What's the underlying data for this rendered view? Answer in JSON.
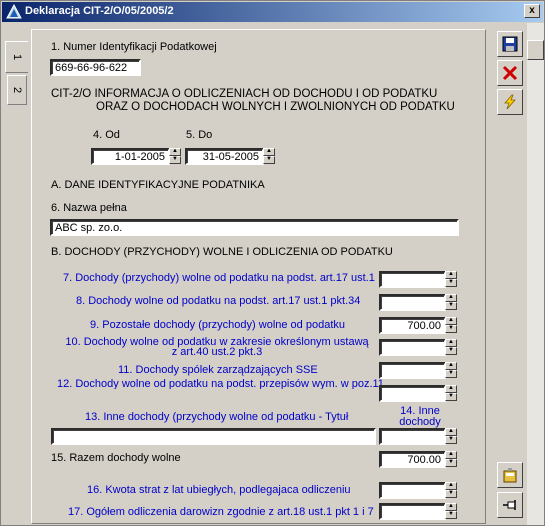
{
  "window": {
    "title": "Deklaracja CIT-2/O/05/2005/2",
    "close": "x"
  },
  "tabs": [
    "1",
    "2"
  ],
  "form": {
    "nip_label": "1. Numer Identyfikacji Podatkowej",
    "nip_value": "669-66-96-622",
    "heading_line1": "CIT-2/O INFORMACJA O ODLICZENIACH OD DOCHODU I OD PODATKU",
    "heading_line2": "ORAZ O DOCHODACH WOLNYCH I ZWOLNIONYCH OD PODATKU",
    "od_label": "4. Od",
    "do_label": "5. Do",
    "od_value": "1-01-2005",
    "do_value": "31-05-2005",
    "section_a": "A. DANE IDENTYFIKACYJNE PODATNIKA",
    "name_label": "6. Nazwa pełna",
    "name_value": "ABC sp. zo.o.",
    "section_b": "B. DOCHODY (PRZYCHODY) WOLNE I ODLICZENIA OD PODATKU",
    "rows": [
      {
        "label": "7. Dochody (przychody) wolne od podatku na podst. art.17 ust.1",
        "value": ""
      },
      {
        "label": "8. Dochody wolne od podatku na podst. art.17 ust.1 pkt.34",
        "value": ""
      },
      {
        "label": "9. Pozostałe dochody (przychody) wolne od podatku",
        "value": "700.00"
      },
      {
        "label": "10. Dochody wolne od podatku w zakresie określonym ustawą z art.40 ust.2 pkt.3",
        "value": ""
      },
      {
        "label": "11. Dochody spólek zarządzających SSE",
        "value": ""
      },
      {
        "label": "12. Dochody wolne od podatku na podst. przepisów wym. w poz.11",
        "value": ""
      }
    ],
    "row13_label": "13. Inne dochody (przychody wolne od podatku - Tytuł",
    "row13_text": "",
    "row14_label": "14. Inne dochody",
    "row14_value": "",
    "row15_label": "15. Razem dochody wolne",
    "row15_value": "700.00",
    "row16_label": "16. Kwota strat z lat ubiegłych, podlegajaca odliczeniu",
    "row16_value": "",
    "row17_label": "17. Ogółem odliczenia darowizn zgodnie z art.18 ust.1 pkt 1 i 7",
    "row17_value": ""
  },
  "toolbar": {
    "icons": [
      "save-icon",
      "cancel-icon",
      "lightning-icon",
      "calculator-icon",
      "pin-icon"
    ]
  },
  "colors": {
    "label_blue": "#0000c8",
    "title_start": "#0a246a",
    "title_end": "#a6caf0"
  }
}
